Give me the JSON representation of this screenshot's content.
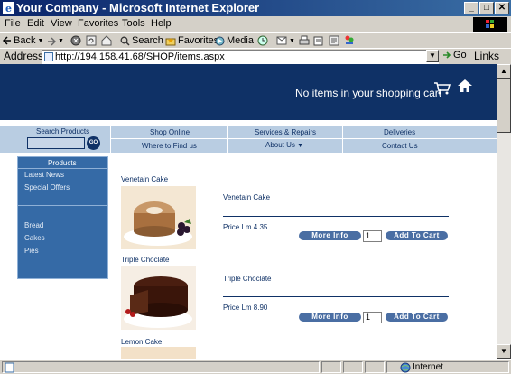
{
  "window": {
    "title": "Your Company - Microsoft Internet Explorer",
    "minimize": "_",
    "restore": "□",
    "close": "✕"
  },
  "menu": [
    "File",
    "Edit",
    "View",
    "Favorites",
    "Tools",
    "Help"
  ],
  "toolbar": {
    "back": "Back",
    "search": "Search",
    "favorites": "Favorites",
    "media": "Media"
  },
  "address": {
    "label": "Address",
    "url": "http://194.158.41.68/SHOP/items.aspx",
    "go": "Go",
    "links": "Links"
  },
  "header": {
    "cart_text": "No items in your shopping cart"
  },
  "nav": {
    "search_label": "Search Products",
    "go_label": "GO",
    "links": [
      "Shop Online",
      "Services & Repairs",
      "Deliveries",
      "Where to Find us",
      "About Us",
      "Contact Us"
    ]
  },
  "sidebar": {
    "title": "Products",
    "top_items": [
      "Latest News",
      "Special Offers"
    ],
    "categories": [
      "Bread",
      "Cakes",
      "Pies"
    ]
  },
  "products": [
    {
      "name": "Venetain Cake",
      "title": "Venetain Cake",
      "price": "Price Lm 4.35",
      "qty": "1"
    },
    {
      "name": "Triple Choclate",
      "title": "Triple Choclate",
      "price": "Price Lm 8.90",
      "qty": "1"
    },
    {
      "name": "Lemon Cake"
    }
  ],
  "buttons": {
    "more_info": "More Info",
    "add_to_cart": "Add To Cart"
  },
  "status": {
    "zone": "Internet"
  },
  "colors": {
    "header": "#0f3166",
    "nav": "#b9cde2",
    "sidebar": "#356aa6",
    "button": "#4a6ea3"
  }
}
